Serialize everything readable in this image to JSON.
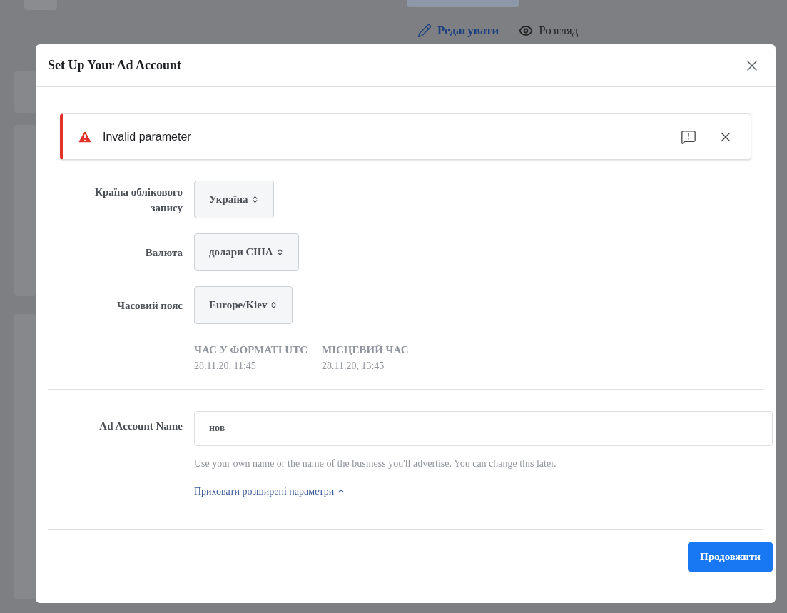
{
  "page_tabs": [
    {
      "label": "Редагувати",
      "kind": "edit",
      "selected": true
    },
    {
      "label": "Розгляд",
      "kind": "view",
      "selected": false
    }
  ],
  "dialog": {
    "title": "Set Up Your Ad Account",
    "alert": {
      "message": "Invalid parameter"
    },
    "fields": [
      {
        "label": "Країна облікового запису",
        "value": "Україна"
      },
      {
        "label": "Валюта",
        "value": "долари США"
      },
      {
        "label": "Часовий пояс",
        "value": "Europe/Kiev"
      }
    ],
    "times": [
      {
        "heading": "ЧАС У ФОРМАТІ UTC",
        "value": "28.11.20, 11:45"
      },
      {
        "heading": "МІСЦЕВИЙ ЧАС",
        "value": "28.11.20, 13:45"
      }
    ],
    "name_field": {
      "label": "Ad Account Name",
      "value": "нов",
      "hint": "Use your own name or the name of the business you'll advertise. You can change this later."
    },
    "advanced_link": {
      "label": "Приховати розширені параметри",
      "expanded": true
    },
    "primary_button": "Продовжити"
  }
}
